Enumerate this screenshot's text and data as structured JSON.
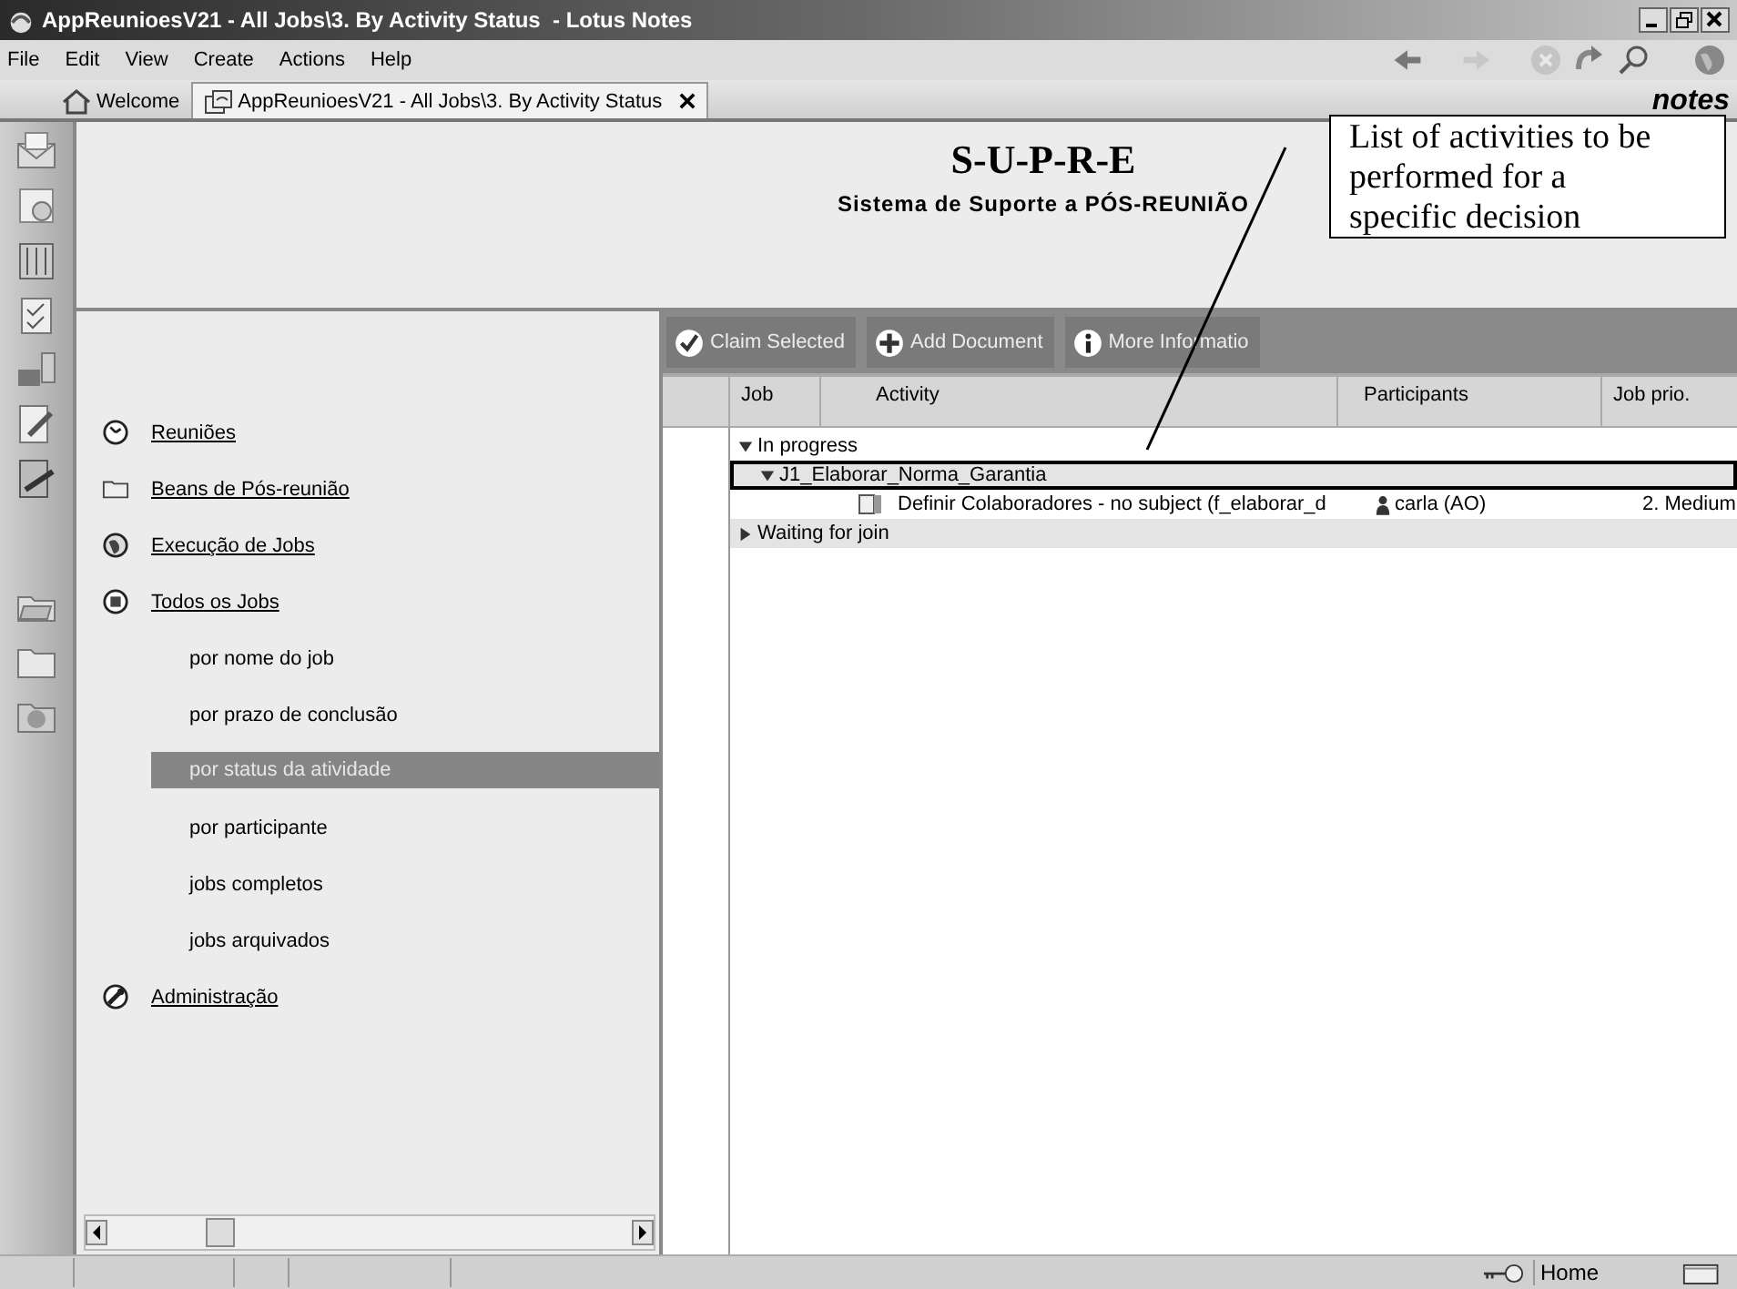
{
  "window": {
    "title": "AppReunioesV21 - All Jobs\\3. By Activity Status  - Lotus Notes"
  },
  "menu": [
    "File",
    "Edit",
    "View",
    "Create",
    "Actions",
    "Help"
  ],
  "tabs": [
    {
      "label": "Welcome",
      "selected": false,
      "closable": false
    },
    {
      "label": "AppReunioesV21 - All Jobs\\3. By Activity Status",
      "selected": true,
      "closable": true
    }
  ],
  "brand": "notes",
  "header": {
    "title": "S-U-P-R-E",
    "subtitle": "Sistema de Suporte a PÓS-REUNIÃO"
  },
  "navigator": [
    {
      "kind": "section",
      "label": "Reuniões",
      "selected": false
    },
    {
      "kind": "section",
      "label": "Beans de Pós-reunião",
      "selected": false
    },
    {
      "kind": "section",
      "label": "Execução de Jobs",
      "selected": false
    },
    {
      "kind": "section",
      "label": "Todos os Jobs",
      "selected": false
    },
    {
      "kind": "view",
      "label": "por nome do job",
      "selected": false
    },
    {
      "kind": "view",
      "label": "por prazo de conclusão",
      "selected": false
    },
    {
      "kind": "view",
      "label": "por status da atividade",
      "selected": true
    },
    {
      "kind": "view",
      "label": "por participante",
      "selected": false
    },
    {
      "kind": "view",
      "label": "jobs completos",
      "selected": false
    },
    {
      "kind": "view",
      "label": "jobs arquivados",
      "selected": false
    },
    {
      "kind": "section",
      "label": "Administração",
      "selected": false
    }
  ],
  "actions": [
    "Claim Selected",
    "Add Document",
    "More Informatio"
  ],
  "view": {
    "columns": [
      "Job",
      "Activity",
      "Participants",
      "Job prio."
    ],
    "rows": [
      {
        "kind": "category",
        "label": "In progress",
        "expanded": true,
        "outlined": false,
        "children": [
          {
            "kind": "category",
            "label": "J1_Elaborar_Norma_Garantia",
            "expanded": true,
            "outlined": true,
            "children": [
              {
                "kind": "document",
                "activity": "Definir Colaboradores - no subject (f_elaborar_d",
                "participant": "carla (AO)",
                "priority": "2. Medium"
              }
            ]
          }
        ]
      },
      {
        "kind": "category",
        "label": "Waiting for join",
        "expanded": false,
        "outlined": false
      }
    ]
  },
  "status_bar": {
    "location": "Home"
  },
  "callout": {
    "text": "List of activities to be performed for a specific decision"
  }
}
